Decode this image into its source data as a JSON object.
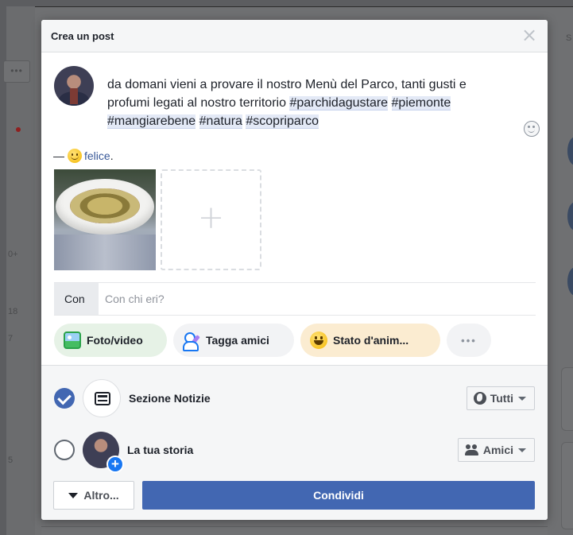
{
  "background": {
    "left_numbers": [
      "0+",
      "18",
      "7",
      "5"
    ],
    "right_label": "S"
  },
  "modal": {
    "title": "Crea un post",
    "close_symbol": "×"
  },
  "composer": {
    "text_plain": "da domani vieni a provare il nostro Menù del Parco, tanti gusti e profumi legati al nostro territorio ",
    "hashtags": [
      "#parchidagustare",
      "#piemonte",
      "#mangiarebene",
      "#natura",
      "#scopriparco"
    ],
    "feeling_prefix": "— ",
    "feeling": "felice",
    "feeling_suffix": "."
  },
  "media": {
    "add_symbol": "+"
  },
  "with": {
    "label": "Con",
    "placeholder": "Con chi eri?"
  },
  "actions": {
    "photo_video": "Foto/video",
    "tag_friends": "Tagga amici",
    "mood": "Stato d'anim...",
    "more": "•••"
  },
  "destinations": [
    {
      "label": "Sezione Notizie",
      "checked": true,
      "audience": "Tutti"
    },
    {
      "label": "La tua storia",
      "checked": false,
      "audience": "Amici"
    }
  ],
  "footer": {
    "more_label": "Altro...",
    "share_label": "Condividi"
  },
  "colors": {
    "brand_blue": "#4267b2",
    "link_blue": "#385898",
    "hashtag_bg": "#e3e9f6"
  }
}
